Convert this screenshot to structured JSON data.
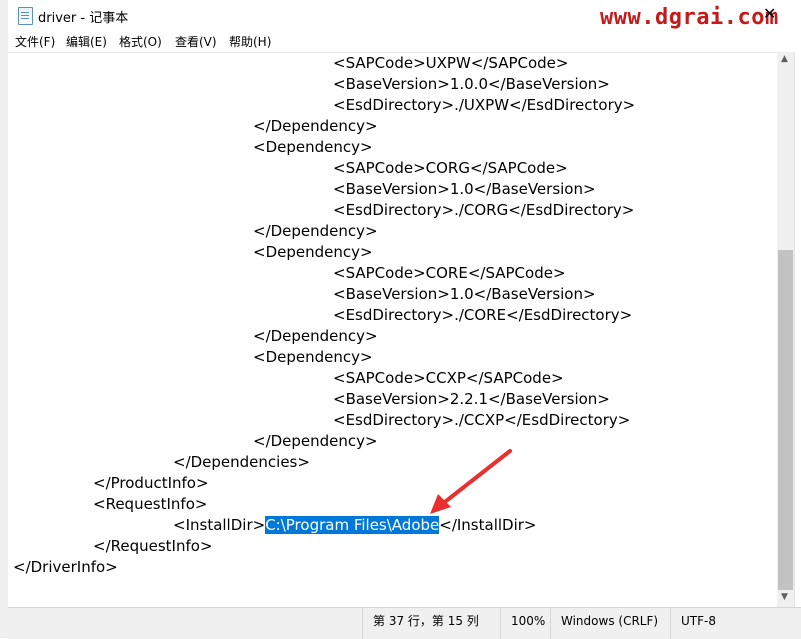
{
  "window": {
    "title": "driver - 记事本",
    "watermark": "www.dgrai.com",
    "close_glyph": "✕"
  },
  "menu": [
    "文件(F)",
    "编辑(E)",
    "格式(O)",
    "查看(V)",
    "帮助(H)"
  ],
  "editor": {
    "lines": [
      "\t\t\t\t<SAPCode>UXPW</SAPCode>",
      "\t\t\t\t<BaseVersion>1.0.0</BaseVersion>",
      "\t\t\t\t<EsdDirectory>./UXPW</EsdDirectory>",
      "\t\t\t</Dependency>",
      "\t\t\t<Dependency>",
      "\t\t\t\t<SAPCode>CORG</SAPCode>",
      "\t\t\t\t<BaseVersion>1.0</BaseVersion>",
      "\t\t\t\t<EsdDirectory>./CORG</EsdDirectory>",
      "\t\t\t</Dependency>",
      "\t\t\t<Dependency>",
      "\t\t\t\t<SAPCode>CORE</SAPCode>",
      "\t\t\t\t<BaseVersion>1.0</BaseVersion>",
      "\t\t\t\t<EsdDirectory>./CORE</EsdDirectory>",
      "\t\t\t</Dependency>",
      "\t\t\t<Dependency>",
      "\t\t\t\t<SAPCode>CCXP</SAPCode>",
      "\t\t\t\t<BaseVersion>2.2.1</BaseVersion>",
      "\t\t\t\t<EsdDirectory>./CCXP</EsdDirectory>",
      "\t\t\t</Dependency>",
      "\t\t</Dependencies>",
      "\t</ProductInfo>",
      "\t<RequestInfo>",
      "\t\t<InstallDir>",
      "\t</RequestInfo>",
      "</DriverInfo>"
    ],
    "selected_text": "C:\\Program Files\\Adobe",
    "after_selection": "</InstallDir>"
  },
  "statusbar": {
    "position": "第 37 行，第 15 列",
    "zoom": "100%",
    "line_ending": "Windows (CRLF)",
    "encoding": "UTF-8"
  },
  "scroll": {
    "up_glyph": "▲",
    "down_glyph": "▼"
  },
  "colors": {
    "selection": "#0078d7",
    "watermark": "#c51a1a",
    "annotation_arrow": "#e8302f"
  }
}
